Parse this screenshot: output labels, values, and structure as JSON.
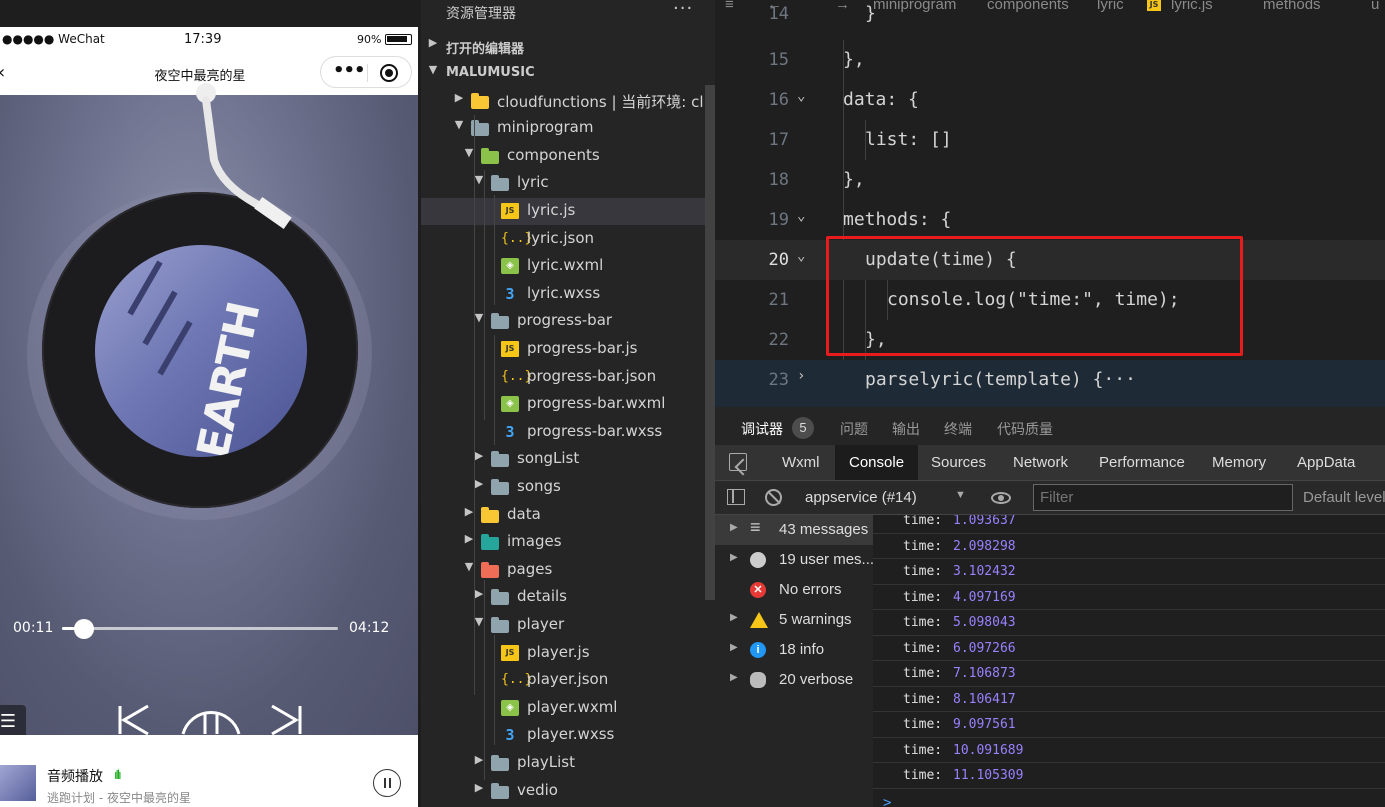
{
  "simulator": {
    "status": {
      "carrier": "●●●●● WeChat",
      "time": "17:39",
      "battery": "90%"
    },
    "nav": {
      "title": "夜空中最亮的星"
    },
    "player": {
      "current_time": "00:11",
      "total_time": "04:12",
      "progress": 0.044,
      "album_text": "EARTH"
    },
    "mini_player": {
      "title": "音频播放",
      "subtitle": "逃跑计划 - 夜空中最亮的星"
    }
  },
  "explorer": {
    "header": "资源管理器",
    "more": "···",
    "open_editors": "打开的编辑器",
    "project": "MALUMUSIC",
    "items": [
      {
        "label": "cloudfunctions | 当前环境: cl...",
        "depth": 1,
        "type": "folder",
        "color": "y",
        "open": false
      },
      {
        "label": "miniprogram",
        "depth": 1,
        "type": "folder",
        "color": "",
        "open": true
      },
      {
        "label": "components",
        "depth": 2,
        "type": "folder",
        "color": "g",
        "open": true
      },
      {
        "label": "lyric",
        "depth": 3,
        "type": "folder",
        "color": "",
        "open": true
      },
      {
        "label": "lyric.js",
        "depth": 4,
        "type": "js",
        "selected": true
      },
      {
        "label": "lyric.json",
        "depth": 4,
        "type": "json"
      },
      {
        "label": "lyric.wxml",
        "depth": 4,
        "type": "wxml"
      },
      {
        "label": "lyric.wxss",
        "depth": 4,
        "type": "wxss"
      },
      {
        "label": "progress-bar",
        "depth": 3,
        "type": "folder",
        "color": "",
        "open": true
      },
      {
        "label": "progress-bar.js",
        "depth": 4,
        "type": "js"
      },
      {
        "label": "progress-bar.json",
        "depth": 4,
        "type": "json"
      },
      {
        "label": "progress-bar.wxml",
        "depth": 4,
        "type": "wxml"
      },
      {
        "label": "progress-bar.wxss",
        "depth": 4,
        "type": "wxss"
      },
      {
        "label": "songList",
        "depth": 3,
        "type": "folder",
        "color": "",
        "open": false
      },
      {
        "label": "songs",
        "depth": 3,
        "type": "folder",
        "color": "",
        "open": false
      },
      {
        "label": "data",
        "depth": 2,
        "type": "folder",
        "color": "y",
        "open": false
      },
      {
        "label": "images",
        "depth": 2,
        "type": "folder",
        "color": "t",
        "open": false
      },
      {
        "label": "pages",
        "depth": 2,
        "type": "folder",
        "color": "o",
        "open": true
      },
      {
        "label": "details",
        "depth": 3,
        "type": "folder",
        "color": "",
        "open": false
      },
      {
        "label": "player",
        "depth": 3,
        "type": "folder",
        "color": "",
        "open": true
      },
      {
        "label": "player.js",
        "depth": 4,
        "type": "js"
      },
      {
        "label": "player.json",
        "depth": 4,
        "type": "json"
      },
      {
        "label": "player.wxml",
        "depth": 4,
        "type": "wxml"
      },
      {
        "label": "player.wxss",
        "depth": 4,
        "type": "wxss"
      },
      {
        "label": "playList",
        "depth": 3,
        "type": "folder",
        "color": "",
        "open": false
      },
      {
        "label": "vedio",
        "depth": 3,
        "type": "folder",
        "color": "",
        "open": false
      }
    ]
  },
  "editor": {
    "breadcrumb": [
      "miniprogram",
      "components",
      "lyric",
      "lyric.js",
      "methods",
      "u"
    ],
    "lines": [
      {
        "n": "14",
        "code": "}"
      },
      {
        "n": "15",
        "code": "},"
      },
      {
        "n": "16",
        "code": "data: {"
      },
      {
        "n": "17",
        "code": "list: []"
      },
      {
        "n": "18",
        "code": "},"
      },
      {
        "n": "19",
        "code": "methods: {"
      },
      {
        "n": "20",
        "code": "update(time) {"
      },
      {
        "n": "21",
        "code": "console.log(\"time:\", time);"
      },
      {
        "n": "22",
        "code": "},"
      },
      {
        "n": "23",
        "code": "parselyric(template) {···"
      }
    ]
  },
  "debugger": {
    "panel_tabs": [
      "调试器",
      "问题",
      "输出",
      "终端",
      "代码质量"
    ],
    "badge": "5",
    "devtools_tabs": [
      "Wxml",
      "Console",
      "Sources",
      "Network",
      "Performance",
      "Memory",
      "AppData"
    ],
    "context": "appservice (#14)",
    "filter_placeholder": "Filter",
    "levels": "Default levels",
    "sidebar": [
      {
        "label": "43 messages",
        "icon": "list-icon"
      },
      {
        "label": "19 user mes...",
        "icon": "user-icon"
      },
      {
        "label": "No errors",
        "icon": "error-icon"
      },
      {
        "label": "5 warnings",
        "icon": "warning-icon"
      },
      {
        "label": "18 info",
        "icon": "info-icon"
      },
      {
        "label": "20 verbose",
        "icon": "bug-icon"
      }
    ],
    "log_key": "time:",
    "logs": [
      "1.093637",
      "2.098298",
      "3.102432",
      "4.097169",
      "5.098043",
      "6.097266",
      "7.106873",
      "8.106417",
      "9.097561",
      "10.091689",
      "11.105309"
    ],
    "prompt": ">"
  }
}
